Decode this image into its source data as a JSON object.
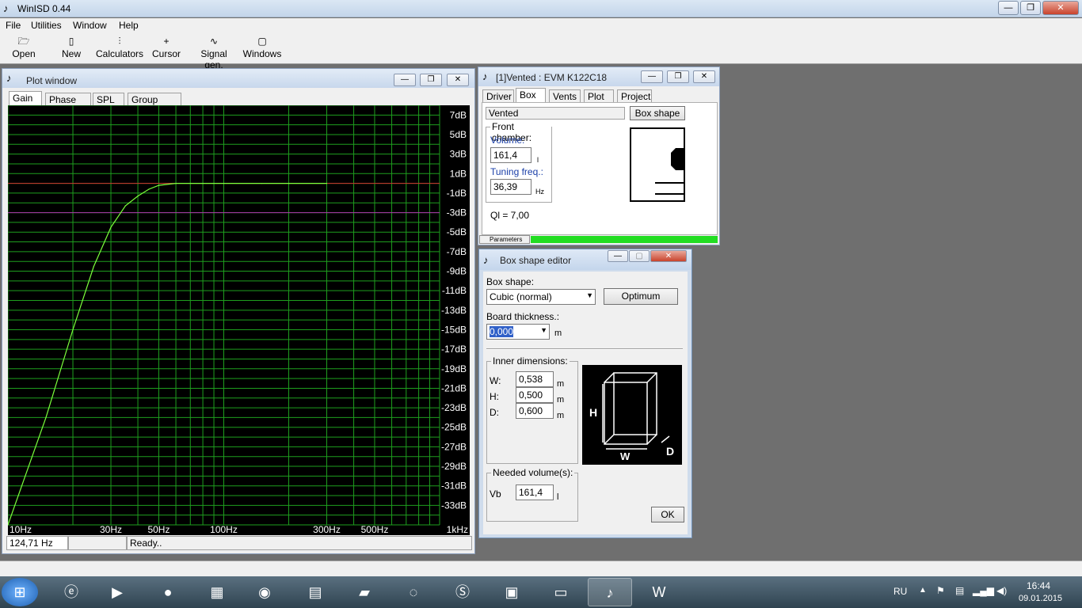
{
  "app": {
    "title": "WinISD 0.44",
    "controls": {
      "minimize": "—",
      "maximize": "❐",
      "close": "✕"
    }
  },
  "menu": [
    "File",
    "Utilities",
    "Window",
    "Help"
  ],
  "toolbar": [
    {
      "label": "Open",
      "icon": "folder-open-icon"
    },
    {
      "label": "New",
      "icon": "new-document-icon"
    },
    {
      "label": "Calculators",
      "icon": "calculator-icon"
    },
    {
      "label": "Cursor",
      "icon": "crosshair-icon"
    },
    {
      "label": "Signal gen.",
      "icon": "signal-generator-icon"
    },
    {
      "label": "Windows",
      "icon": "windows-icon"
    }
  ],
  "plot_window": {
    "title": "Plot window",
    "tabs": [
      "Gain",
      "Phase plot",
      "SPL",
      "Group delay"
    ],
    "active_tab": "Gain",
    "status": {
      "freq": "124,71 Hz",
      "state": "Ready.."
    },
    "colors": {
      "background": "#000000",
      "grid": "#1e9e1e",
      "curve": "#7cff3c",
      "ref_line": "#d03030",
      "ref_line2": "#b030b0"
    }
  },
  "chart_data": {
    "type": "line",
    "title": "",
    "xlabel": "",
    "ylabel": "",
    "x_scale": "log",
    "xlim": [
      10,
      1000
    ],
    "ylim": [
      -35,
      8
    ],
    "x_ticks": [
      "10Hz",
      "30Hz",
      "50Hz",
      "100Hz",
      "300Hz",
      "500Hz",
      "1kHz"
    ],
    "x_tick_values": [
      10,
      30,
      50,
      100,
      300,
      500,
      1000
    ],
    "y_ticks": [
      "7dB",
      "5dB",
      "3dB",
      "1dB",
      "-1dB",
      "-3dB",
      "-5dB",
      "-7dB",
      "-9dB",
      "-11dB",
      "-13dB",
      "-15dB",
      "-17dB",
      "-19dB",
      "-21dB",
      "-23dB",
      "-25dB",
      "-27dB",
      "-29dB",
      "-31dB",
      "-33dB"
    ],
    "y_tick_values": [
      7,
      5,
      3,
      1,
      -1,
      -3,
      -5,
      -7,
      -9,
      -11,
      -13,
      -15,
      -17,
      -19,
      -21,
      -23,
      -25,
      -27,
      -29,
      -31,
      -33
    ],
    "reference_lines": [
      0,
      -3
    ],
    "grid": true,
    "series": [
      {
        "x": [
          10,
          15,
          20,
          25,
          30,
          35,
          40,
          45,
          50,
          60,
          80,
          100,
          150,
          200,
          300
        ],
        "y": [
          -35,
          -24,
          -15,
          -8.5,
          -4.5,
          -2.3,
          -1.3,
          -0.6,
          -0.2,
          0,
          0,
          0,
          0,
          0,
          0
        ]
      }
    ]
  },
  "vented_window": {
    "title": "[1]Vented : EVM K122C18",
    "tabs": [
      "Driver",
      "Box",
      "Vents",
      "Plot",
      "Project"
    ],
    "active_tab": "Box",
    "box_type": "Vented",
    "box_shape_button": "Box shape",
    "front_chamber": {
      "legend": "Front chamber:",
      "volume_label": "Volume:",
      "volume_value": "161,4",
      "volume_unit": "l",
      "tuning_label": "Tuning freq.:",
      "tuning_value": "36,39",
      "tuning_unit": "Hz"
    },
    "ql": "Ql = 7,00",
    "parameters_tab": "Parameters",
    "progress": 1.0,
    "progress_color": "#22dd22"
  },
  "box_shape_editor": {
    "title": "Box shape editor",
    "box_shape_label": "Box shape:",
    "box_shape_value": "Cubic (normal)",
    "optimum_button": "Optimum",
    "board_thickness_label": "Board thickness.:",
    "board_thickness_value": "0,000",
    "board_thickness_unit": "m",
    "inner_dims": {
      "legend": "Inner dimensions:",
      "w_label": "W:",
      "w_value": "0,538",
      "h_label": "H:",
      "h_value": "0,500",
      "d_label": "D:",
      "d_value": "0,600",
      "unit": "m"
    },
    "diagram_labels": {
      "h": "H",
      "w": "W",
      "d": "D"
    },
    "needed_volume": {
      "legend": "Needed volume(s):",
      "vb_label": "Vb",
      "vb_value": "161,4",
      "unit": "l"
    },
    "ok_button": "OK"
  },
  "taskbar": {
    "apps": [
      "start-orb-icon",
      "ie-icon",
      "media-player-icon",
      "app-orb-icon",
      "file-manager-icon",
      "chrome-icon",
      "explorer-icon",
      "folder-icon",
      "spiral-app-icon",
      "skype-icon",
      "control-panel-icon",
      "monitor-app-icon",
      "winisd-icon",
      "word-icon"
    ],
    "lang": "RU",
    "time": "16:44",
    "date": "09.01.2015"
  }
}
